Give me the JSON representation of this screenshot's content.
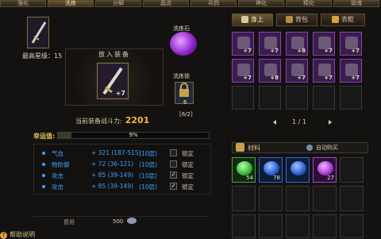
{
  "top_tabs": [
    "强化",
    "洗炼",
    "分解",
    "晶烫",
    "兵鸽",
    "神化",
    "精化",
    "锻魂"
  ],
  "active_top_tab": 1,
  "equipment": {
    "max_star_label": "最高星级：",
    "max_star_value": "15",
    "slot_title": "放入装备",
    "plus_level": "+7",
    "combat_power_label": "当前装备战斗力:",
    "combat_power_value": "2201"
  },
  "wash_stone": {
    "label": "洗炼石"
  },
  "wash_lock": {
    "label": "洗炼锁",
    "count": "6",
    "ratio": "[6/2]"
  },
  "luck": {
    "label": "幸运值:",
    "percent": 9,
    "display": "9%"
  },
  "stats": [
    {
      "name": "气血",
      "value": "+ 321 (187-515)",
      "layer": "(10层)",
      "checked": false,
      "lock_label": "锁定"
    },
    {
      "name": "物防御",
      "value": "+ 72 (36-121)",
      "layer": "(10层)",
      "checked": false,
      "lock_label": "锁定"
    },
    {
      "name": "攻击",
      "value": "+ 85 (39-149)",
      "layer": "(10层)",
      "checked": true,
      "lock_label": "锁定"
    },
    {
      "name": "攻击",
      "value": "+ 85 (39-149)",
      "layer": "(10层)",
      "checked": true,
      "lock_label": "锁定"
    }
  ],
  "fee": {
    "label": "费用",
    "value": "500"
  },
  "help": {
    "label": "帮助说明"
  },
  "inventory_tabs": [
    {
      "label": "身上",
      "active": true,
      "color": "#d7c89a"
    },
    {
      "label": "背包",
      "active": false,
      "color": "#b58a4a"
    },
    {
      "label": "衣柜",
      "active": false,
      "color": "#d8a43a"
    }
  ],
  "inventory_items": [
    "+7",
    "+7",
    "+8",
    "+7",
    "+7",
    "+7",
    "+8",
    "+7",
    "+7",
    "+7"
  ],
  "pager": {
    "text": "1 / 1"
  },
  "materials": {
    "label": "材料",
    "auto_buy": "自动购买",
    "items": [
      {
        "count": "54",
        "color": "#3fbf3f"
      },
      {
        "count": "78",
        "color": "#2f66d8"
      },
      {
        "count": "",
        "color": "#2f66d8"
      },
      {
        "count": "27",
        "color": "#b23fd8"
      }
    ]
  }
}
